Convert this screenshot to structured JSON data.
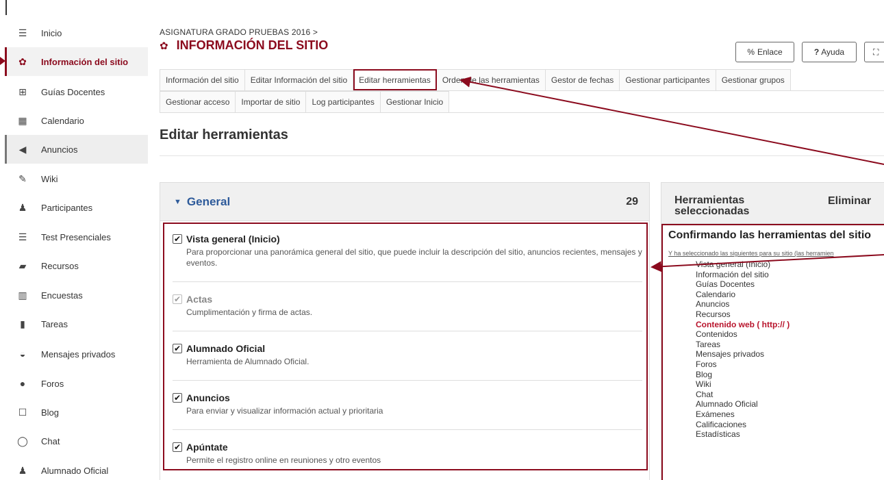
{
  "sidebar": {
    "items": [
      {
        "label": "Inicio",
        "icon": "list-icon",
        "glyph": "☰"
      },
      {
        "label": "Información del sitio",
        "icon": "gear-icon",
        "glyph": "✿"
      },
      {
        "label": "Guías Docentes",
        "icon": "map-icon",
        "glyph": "⊞"
      },
      {
        "label": "Calendario",
        "icon": "calendar-icon",
        "glyph": "▦"
      },
      {
        "label": "Anuncios",
        "icon": "megaphone-icon",
        "glyph": "◀"
      },
      {
        "label": "Wiki",
        "icon": "edit-icon",
        "glyph": "✎"
      },
      {
        "label": "Participantes",
        "icon": "users-icon",
        "glyph": "♟"
      },
      {
        "label": "Test Presenciales",
        "icon": "list-icon",
        "glyph": "☰"
      },
      {
        "label": "Recursos",
        "icon": "folder-open-icon",
        "glyph": "▰"
      },
      {
        "label": "Encuestas",
        "icon": "bar-chart-icon",
        "glyph": "▥"
      },
      {
        "label": "Tareas",
        "icon": "file-icon",
        "glyph": "▮"
      },
      {
        "label": "Mensajes privados",
        "icon": "inbox-icon",
        "glyph": "◒"
      },
      {
        "label": "Foros",
        "icon": "comments-icon",
        "glyph": "●"
      },
      {
        "label": "Blog",
        "icon": "square-icon",
        "glyph": "☐"
      },
      {
        "label": "Chat",
        "icon": "chat-icon",
        "glyph": "◯"
      },
      {
        "label": "Alumnado Oficial",
        "icon": "users-icon",
        "glyph": "♟"
      }
    ]
  },
  "header": {
    "breadcrumb": "ASIGNATURA GRADO PRUEBAS 2016  >",
    "title": "INFORMACIÓN DEL SITIO",
    "title_icon": "✿",
    "btn_link": "Enlace",
    "btn_link_icon": "%",
    "btn_help": "Ayuda",
    "btn_help_icon": "?",
    "btn_expand_icon": "⛶"
  },
  "tabs": {
    "row1": [
      "Información del sitio",
      "Editar Información del sitio",
      "Editar herramientas",
      "Orden de las herramientas",
      "Gestor de fechas",
      "Gestionar participantes",
      "Gestionar grupos"
    ],
    "row2": [
      "Gestionar acceso",
      "Importar de sitio",
      "Log participantes",
      "Gestionar Inicio"
    ]
  },
  "main": {
    "section_title": "Editar herramientas",
    "group_title": "General",
    "group_count": "29",
    "tools": [
      {
        "name": "Vista general (Inicio)",
        "desc": "Para proporcionar una panorámica general del sitio, que puede incluir la descripción del sitio, anuncios recientes, mensajes y eventos.",
        "disabled": false
      },
      {
        "name": "Actas",
        "desc": "Cumplimentación y firma de actas.",
        "disabled": true
      },
      {
        "name": "Alumnado Oficial",
        "desc": "Herramienta de Alumnado Oficial.",
        "disabled": false
      },
      {
        "name": "Anuncios",
        "desc": "Para enviar y visualizar información actual y prioritaria",
        "disabled": false
      },
      {
        "name": "Apúntate",
        "desc": "Permite el registro online en reuniones y otro eventos",
        "disabled": false
      }
    ]
  },
  "right": {
    "header_title": "Herramientas seleccionadas",
    "header_action": "Eliminar",
    "confirm_title": "Confirmando las herramientas del sitio",
    "confirm_note": "Y ha seleccionado las siguientes para su sitio (las herramien",
    "selected": [
      "Vista general (Inicio)",
      "Información del sitio",
      "Guías Docentes",
      "Calendario",
      "Anuncios",
      "Recursos",
      "Contenido web ( http:// )",
      "Contenidos",
      "Tareas",
      "Mensajes privados",
      "Foros",
      "Blog",
      "Wiki",
      "Chat",
      "Alumnado Oficial",
      "Exámenes",
      "Calificaciones",
      "Estadísticas"
    ],
    "highlighted_item": "Contenido web ( http:// )"
  },
  "colors": {
    "accent": "#8b0a1d",
    "link_blue": "#2d5a9a",
    "highlight_red": "#b8132b"
  }
}
